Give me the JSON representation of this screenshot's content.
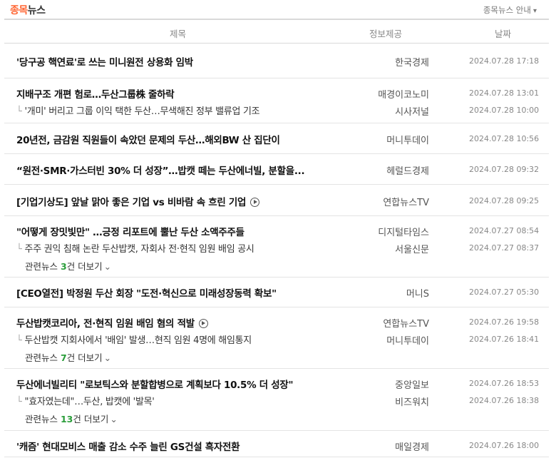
{
  "header": {
    "brand_part1": "종목",
    "brand_part2": "뉴스",
    "guide_label": "종목뉴스 안내",
    "guide_icon": "chevron-down-icon"
  },
  "columns": {
    "title": "제목",
    "source": "정보제공",
    "date": "날짜"
  },
  "news": [
    {
      "title": "'당구공 핵연료'로 쓰는 미니원전 상용화 임박",
      "source": "한국경제",
      "date": "2024.07.28 17:18",
      "subs": []
    },
    {
      "title": "지배구조 개편 험로…두산그룹株 줄하락",
      "source": "매경이코노미",
      "date": "2024.07.28 13:01",
      "subs": [
        {
          "title": "'개미' 버리고 그룹 이익 택한 두산…무색해진 정부 밸류업 기조",
          "source": "시사저널",
          "date": "2024.07.28 10:00"
        }
      ]
    },
    {
      "title": "20년전, 금감원 직원들이 속았던 문제의 두산…해외BW 산 집단이",
      "source": "머니투데이",
      "date": "2024.07.28 10:56",
      "subs": []
    },
    {
      "title": "“원전·SMR·가스터빈 30% 더 성장”…밥캣 떼는 두산에너빌, 분할을...",
      "source": "헤럴드경제",
      "date": "2024.07.28 09:32",
      "subs": []
    },
    {
      "title": "[기업기상도] 앞날 맑아 좋은 기업 vs 비바람 속 흐린 기업",
      "video": true,
      "source": "연합뉴스TV",
      "date": "2024.07.28 09:25",
      "subs": []
    },
    {
      "title": "\"어떻게 장밋빛만\" …긍정 리포트에 뿔난 두산 소액주주들",
      "source": "디지털타임스",
      "date": "2024.07.27 08:54",
      "subs": [
        {
          "title": "주주 권익 침해 논란 두산밥캣, 자회사 전·현직 임원 배임 공시",
          "source": "서울신문",
          "date": "2024.07.27 08:37"
        }
      ],
      "related": {
        "prefix": "관련뉴스 ",
        "count": "3",
        "suffix": "건 더보기"
      }
    },
    {
      "title": "[CEO열전] 박정원 두산 회장 \"도전·혁신으로 미래성장동력 확보\"",
      "source": "머니S",
      "date": "2024.07.27 05:30",
      "subs": []
    },
    {
      "title": "두산밥캣코리아, 전·현직 임원 배임 혐의 적발",
      "video": true,
      "source": "연합뉴스TV",
      "date": "2024.07.26 19:58",
      "subs": [
        {
          "title": "두산밥캣 지회사에서 '배임' 발생…현직 임원 4명에 해임통지",
          "source": "머니투데이",
          "date": "2024.07.26 18:41"
        }
      ],
      "related": {
        "prefix": "관련뉴스 ",
        "count": "7",
        "suffix": "건 더보기"
      }
    },
    {
      "title": "두산에너빌리티 \"로보틱스와 분할합병으로 계획보다 10.5% 더 성장\"",
      "source": "중앙일보",
      "date": "2024.07.26 18:53",
      "subs": [
        {
          "title": "\"효자였는데\"…두산, 밥캣에 '발목'",
          "source": "비즈워치",
          "date": "2024.07.26 18:38"
        }
      ],
      "related": {
        "prefix": "관련뉴스 ",
        "count": "13",
        "suffix": "건 더보기"
      }
    },
    {
      "title": "'캐즘' 현대모비스 매출 감소 수주 늘린 GS건설 흑자전환",
      "source": "매일경제",
      "date": "2024.07.26 18:00",
      "subs": []
    }
  ]
}
